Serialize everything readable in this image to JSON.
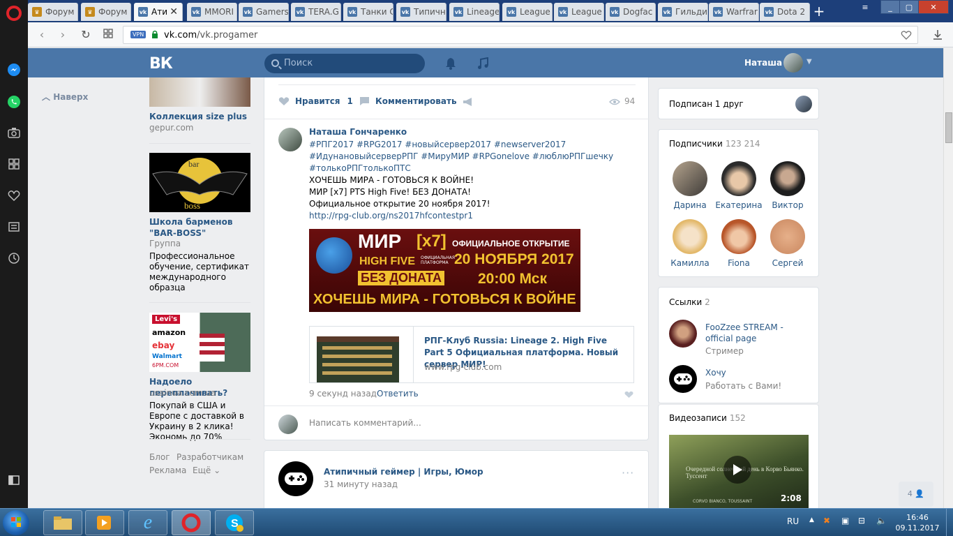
{
  "tabs": [
    {
      "label": "Форум",
      "icon": "forum"
    },
    {
      "label": "Форум",
      "icon": "forum"
    },
    {
      "label": "Ати",
      "icon": "vk",
      "active": true
    },
    {
      "label": "MMORI",
      "icon": "vk"
    },
    {
      "label": "Gamers",
      "icon": "vk"
    },
    {
      "label": "TERA.G",
      "icon": "vk"
    },
    {
      "label": "Танки С",
      "icon": "vk"
    },
    {
      "label": "Типичн",
      "icon": "vk"
    },
    {
      "label": "Lineage",
      "icon": "vk"
    },
    {
      "label": "League",
      "icon": "vk"
    },
    {
      "label": "League",
      "icon": "vk"
    },
    {
      "label": "Dogfac",
      "icon": "vk"
    },
    {
      "label": "Гильди",
      "icon": "vk"
    },
    {
      "label": "Warfrar",
      "icon": "vk"
    },
    {
      "label": "Dota 2",
      "icon": "vk"
    }
  ],
  "address": {
    "vpn": "VPN",
    "host": "vk.com",
    "path": "/vk.progamer"
  },
  "header": {
    "search_placeholder": "Поиск",
    "username": "Наташа"
  },
  "left": {
    "up": "Наверх",
    "ads": [
      {
        "title": "Коллекция size plus",
        "domain": "gepur.com"
      },
      {
        "img_text": "BAR BOSS",
        "title": "Школа барменов \"BAR-BOSS\"",
        "sub": "Группа",
        "desc": "Профессиональное обучение, сертификат международного образца"
      },
      {
        "img_text": "Levi's amazon ebay Walmart 6PM.COM",
        "title": "Надоело переплачивать?",
        "domain": "usainua.com.ua",
        "desc": "Покупай в США и Европе с доставкой в Украину в 2 клика! Экономь до 70%"
      }
    ],
    "footer": [
      "Блог",
      "Разработчикам",
      "Реклама",
      "Ещё"
    ]
  },
  "post": {
    "like_label": "Нравится",
    "like_count": "1",
    "comment_label": "Комментировать",
    "views": "94"
  },
  "comment": {
    "author": "Наташа Гончаренко",
    "tags1": "#РПГ2017 #RPG2017 #новыйсервер2017 #newserver2017",
    "tags2": "#ИдунановыйсерверРПГ #МируМИР #RPGonelove #люблюРПГшечку",
    "tags3": "#толькоРПГтолькоПТС",
    "line1": "ХОЧЕШЬ МИРА - ГОТОВЬСЯ К ВОЙНЕ!",
    "line2": "МИР [x7] PTS High Five! БЕЗ ДОНАТА!",
    "line3": "Официальное открытие 20 ноября 2017!",
    "url": "http://rpg-club.org/ns2017hfcontestpr1",
    "banner": {
      "mir": "МИР",
      "x7": "[x7]",
      "open": "ОФИЦИАЛЬНОЕ ОТКРЫТИЕ",
      "hf": "HIGH FIVE",
      "platform": "ОФИЦИАЛЬНАЯ ПЛАТФОРМА",
      "date": "20 НОЯБРЯ 2017",
      "nodonate": "БЕЗ ДОНАТА",
      "time": "20:00 Мск",
      "slogan": "ХОЧЕШЬ МИРА - ГОТОВЬСЯ К ВОЙНЕ"
    },
    "linkcard": {
      "title": "РПГ-Клуб Russia: Lineage 2. High Five Part 5 Официальная платформа. Новый сервер МИР!",
      "domain": "www.rpg-club.com"
    },
    "time": "9 секунд назад",
    "reply": "Ответить",
    "write_placeholder": "Написать комментарий..."
  },
  "nextpost": {
    "author": "Атипичный геймер | Игры, Юмор",
    "time": "31 минуту назад"
  },
  "right": {
    "subscribed": "Подписан 1 друг",
    "subs_title": "Подписчики",
    "subs_count": "123 214",
    "people": [
      "Дарина",
      "Екатерина",
      "Виктор",
      "Камилла",
      "Fiona",
      "Сергей"
    ],
    "links_title": "Ссылки",
    "links_count": "2",
    "links": [
      {
        "name": "FooZzee STREAM - official page",
        "desc": "Стример"
      },
      {
        "name": "Хочу",
        "desc": "Работать с Вами!"
      }
    ],
    "video_title": "Видеозаписи",
    "video_count": "152",
    "video_caption": "Очередной солнечный день в Корво Бьянко. Туссент",
    "video_sub": "CORVO BIANCO, TOUSSAINT",
    "video_duration": "2:08"
  },
  "friends_count": "4",
  "taskbar": {
    "lang": "RU",
    "time": "16:46",
    "date": "09.11.2017"
  }
}
